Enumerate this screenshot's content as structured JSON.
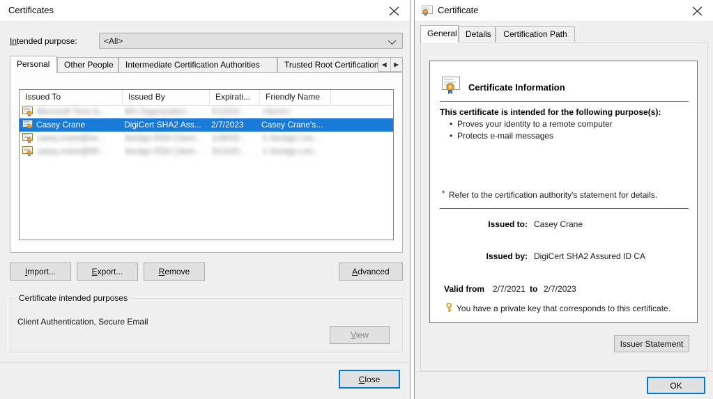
{
  "certificates_window": {
    "title": "Certificates",
    "close_icon": "close-icon",
    "intended_purpose_label": "Intended purpose:",
    "intended_purpose_value": "<All>",
    "dropdown_icon": "chevron-down-icon",
    "tabs": [
      {
        "label": "Personal",
        "active": true
      },
      {
        "label": "Other People",
        "active": false
      },
      {
        "label": "Intermediate Certification Authorities",
        "active": false
      },
      {
        "label": "Trusted Root Certification",
        "active": false
      }
    ],
    "tab_scroll_left_icon": "triangle-left-icon",
    "tab_scroll_right_icon": "triangle-right-icon",
    "list": {
      "columns": [
        "Issued To",
        "Issued By",
        "Expirati...",
        "Friendly Name"
      ],
      "rows": [
        {
          "blurred": true,
          "selected": false,
          "issued_to": "Microsoft Time-S...",
          "issued_by": "MS Organization ...",
          "expiration": "5/13/20...",
          "friendly_name": "<None>"
        },
        {
          "blurred": false,
          "selected": true,
          "issued_to": "Casey Crane",
          "issued_by": "DigiCert SHA2 Ass...",
          "expiration": "2/7/2023",
          "friendly_name": "Casey Crane's..."
        },
        {
          "blurred": true,
          "selected": false,
          "issued_to": "casey.crane@se...",
          "issued_by": "Sectigo RSA Client...",
          "expiration": "1/28/20...",
          "friendly_name": "'s Sectigo Lim..."
        },
        {
          "blurred": true,
          "selected": false,
          "issued_to": "casey.crane@80...",
          "issued_by": "Sectigo RSA Client...",
          "expiration": "3/13/20...",
          "friendly_name": "'s Sectigo Lim..."
        }
      ]
    },
    "buttons": {
      "import": "Import...",
      "export": "Export...",
      "remove": "Remove",
      "advanced": "Advanced",
      "view": "View",
      "close": "Close"
    },
    "groupbox": {
      "title": "Certificate intended purposes",
      "text": "Client Authentication, Secure Email"
    }
  },
  "certificate_window": {
    "title": "Certificate",
    "title_icon": "certificate-icon",
    "close_icon": "close-icon",
    "tabs": [
      {
        "label": "General",
        "active": true
      },
      {
        "label": "Details",
        "active": false
      },
      {
        "label": "Certification Path",
        "active": false
      }
    ],
    "info_icon": "certificate-seal-icon",
    "info_title": "Certificate Information",
    "purpose_heading": "This certificate is intended for the following purpose(s):",
    "purposes": [
      "Proves your identity to a remote computer",
      "Protects e-mail messages"
    ],
    "footnote": "Refer to the certification authority's statement for details.",
    "footnote_marker": "*",
    "issued_to_label": "Issued to:",
    "issued_to_value": "Casey Crane",
    "issued_by_label": "Issued by:",
    "issued_by_value": "DigiCert SHA2 Assured ID CA",
    "valid_from_label": "Valid from",
    "valid_from_value": "2/7/2021",
    "valid_to_label": "to",
    "valid_to_value": "2/7/2023",
    "private_key_icon": "key-icon",
    "private_key_note": "You have a private key that corresponds to this certificate.",
    "issuer_statement_button": "Issuer Statement",
    "ok_button": "OK"
  },
  "colors": {
    "selection_blue": "#1a7ad9",
    "focus_blue": "#0078d7",
    "dialog_bg": "#f0f0f0",
    "panel_white": "#ffffff",
    "seal_gold": "#e8a33d"
  }
}
